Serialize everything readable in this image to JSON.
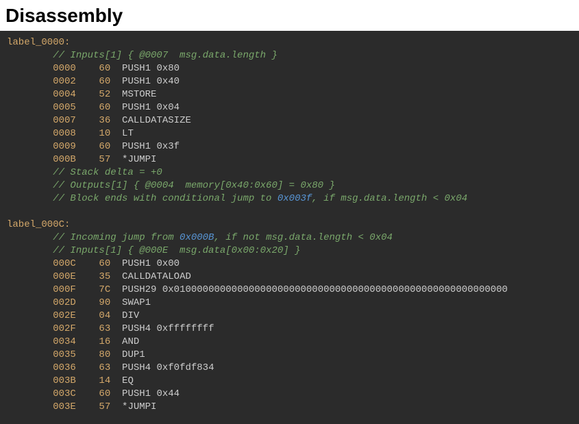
{
  "title": "Disassembly",
  "labels": [
    {
      "name": "label_0000:",
      "lines": [
        {
          "type": "comment",
          "text": "// Inputs[1] { @0007  msg.data.length }"
        },
        {
          "type": "instr",
          "offset": "0000",
          "byte": "60",
          "op": "PUSH1 0x80"
        },
        {
          "type": "instr",
          "offset": "0002",
          "byte": "60",
          "op": "PUSH1 0x40"
        },
        {
          "type": "instr",
          "offset": "0004",
          "byte": "52",
          "op": "MSTORE"
        },
        {
          "type": "instr",
          "offset": "0005",
          "byte": "60",
          "op": "PUSH1 0x04"
        },
        {
          "type": "instr",
          "offset": "0007",
          "byte": "36",
          "op": "CALLDATASIZE"
        },
        {
          "type": "instr",
          "offset": "0008",
          "byte": "10",
          "op": "LT"
        },
        {
          "type": "instr",
          "offset": "0009",
          "byte": "60",
          "op": "PUSH1 0x3f"
        },
        {
          "type": "instr",
          "offset": "000B",
          "byte": "57",
          "op": "*JUMPI"
        },
        {
          "type": "comment",
          "text": "// Stack delta = +0"
        },
        {
          "type": "comment",
          "text": "// Outputs[1] { @0004  memory[0x40:0x60] = 0x80 }"
        },
        {
          "type": "comment-jump",
          "pre": "// Block ends with conditional jump to ",
          "ref": "0x003f",
          "post": ", if msg.data.length < 0x04"
        }
      ]
    },
    {
      "name": "label_000C:",
      "lines": [
        {
          "type": "comment-jump",
          "pre": "// Incoming jump from ",
          "ref": "0x000B",
          "post": ", if not msg.data.length < 0x04"
        },
        {
          "type": "comment",
          "text": "// Inputs[1] { @000E  msg.data[0x00:0x20] }"
        },
        {
          "type": "instr",
          "offset": "000C",
          "byte": "60",
          "op": "PUSH1 0x00"
        },
        {
          "type": "instr",
          "offset": "000E",
          "byte": "35",
          "op": "CALLDATALOAD"
        },
        {
          "type": "instr",
          "offset": "000F",
          "byte": "7C",
          "op": "PUSH29 0x0100000000000000000000000000000000000000000000000000000000"
        },
        {
          "type": "instr",
          "offset": "002D",
          "byte": "90",
          "op": "SWAP1"
        },
        {
          "type": "instr",
          "offset": "002E",
          "byte": "04",
          "op": "DIV"
        },
        {
          "type": "instr",
          "offset": "002F",
          "byte": "63",
          "op": "PUSH4 0xffffffff"
        },
        {
          "type": "instr",
          "offset": "0034",
          "byte": "16",
          "op": "AND"
        },
        {
          "type": "instr",
          "offset": "0035",
          "byte": "80",
          "op": "DUP1"
        },
        {
          "type": "instr",
          "offset": "0036",
          "byte": "63",
          "op": "PUSH4 0xf0fdf834"
        },
        {
          "type": "instr",
          "offset": "003B",
          "byte": "14",
          "op": "EQ"
        },
        {
          "type": "instr",
          "offset": "003C",
          "byte": "60",
          "op": "PUSH1 0x44"
        },
        {
          "type": "instr",
          "offset": "003E",
          "byte": "57",
          "op": "*JUMPI"
        }
      ]
    }
  ]
}
